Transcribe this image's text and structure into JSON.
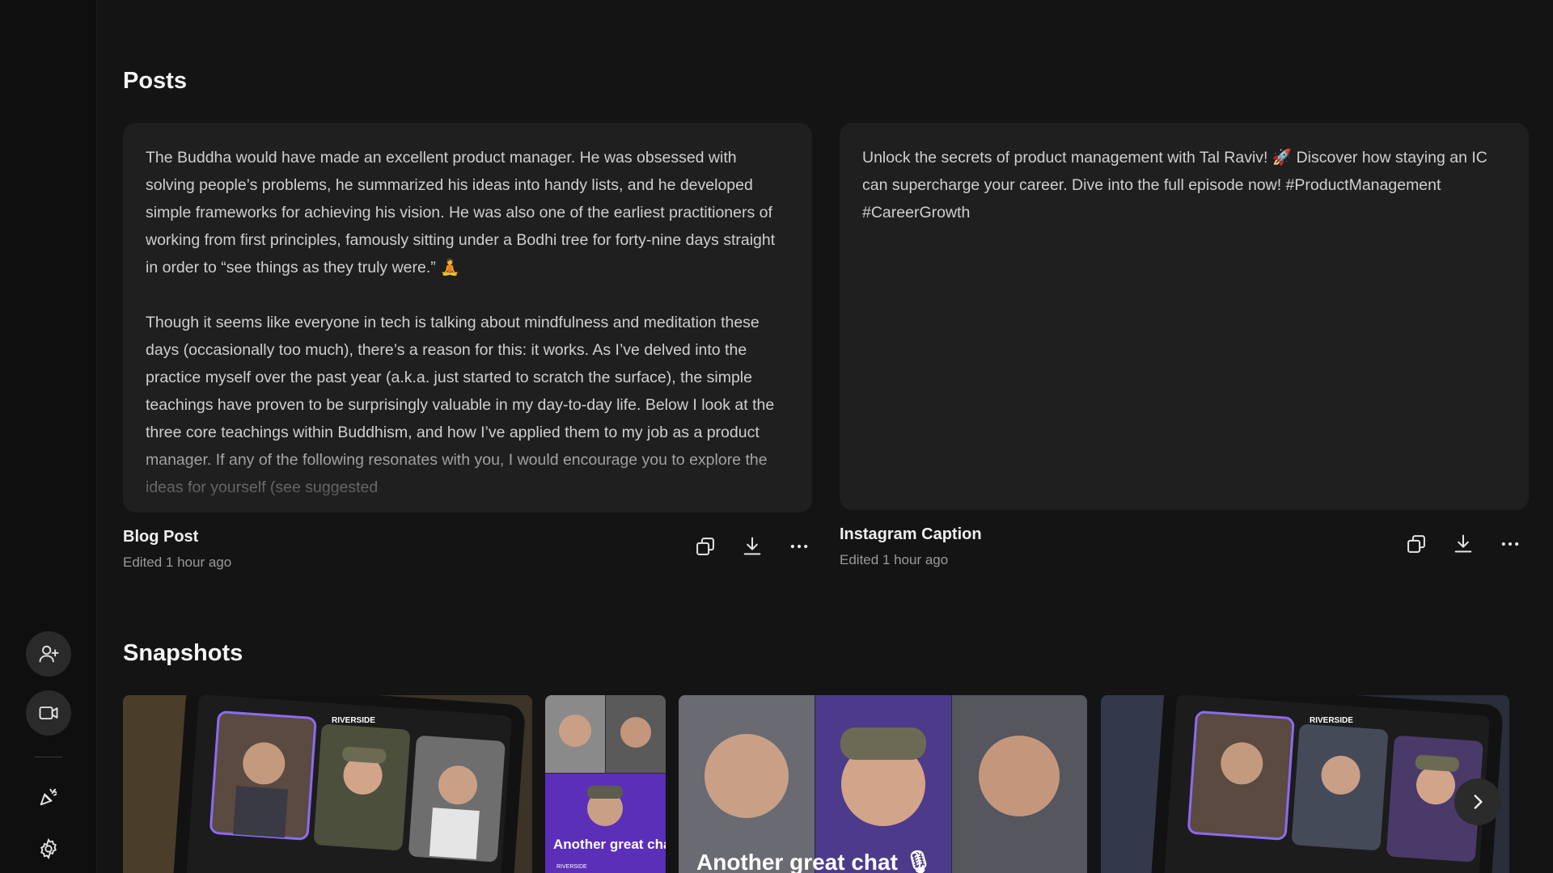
{
  "sections": {
    "posts_title": "Posts",
    "snapshots_title": "Snapshots"
  },
  "posts": [
    {
      "paragraphs": [
        "The Buddha would have made an excellent product manager. He was obsessed with solving people’s problems, he summarized his ideas into handy lists, and he developed simple frameworks for achieving his vision. He was also one of the earliest practitioners of working from first principles, famously sitting under a Bodhi tree for forty-nine days straight in order to “see things as they truly were.” 🧘",
        "Though it seems like everyone in tech is talking about mindfulness and meditation these days (occasionally too much), there’s a reason for this: it works. As I’ve delved into the practice myself over the past year (a.k.a. just started to scratch the surface), the simple teachings have proven to be surprisingly valuable in my day-to-day life. Below I look at the three core teachings within Buddhism, and how I’ve applied them to my job as a product manager. If any of the following resonates with you, I would encourage you to explore the ideas for yourself (see suggested"
      ],
      "title": "Blog Post",
      "edited": "Edited 1 hour ago"
    },
    {
      "paragraphs": [
        "Unlock the secrets of product management with Tal Raviv! 🚀 Discover how staying an IC can supercharge your career. Dive into the full episode now! #ProductManagement #CareerGrowth"
      ],
      "title": "Instagram Caption",
      "edited": "Edited 1 hour ago"
    }
  ],
  "snapshots": {
    "brand": "RIVERSIDE",
    "overlay_text": "Another great chat 🎙",
    "overlay_text_short": "Another great chat 🎙",
    "brand_small": "RIVERSIDE"
  },
  "icons": {
    "sidebar": [
      "add-user-icon",
      "video-camera-icon",
      "party-popper-icon",
      "gear-icon"
    ],
    "actions": [
      "copy-icon",
      "download-icon",
      "more-icon"
    ],
    "next": "chevron-right-icon"
  },
  "colors": {
    "background": "#141414",
    "card": "#1f1f1f",
    "sidebar": "#0f0f0f",
    "accent_purple": "#6b3fd1"
  }
}
